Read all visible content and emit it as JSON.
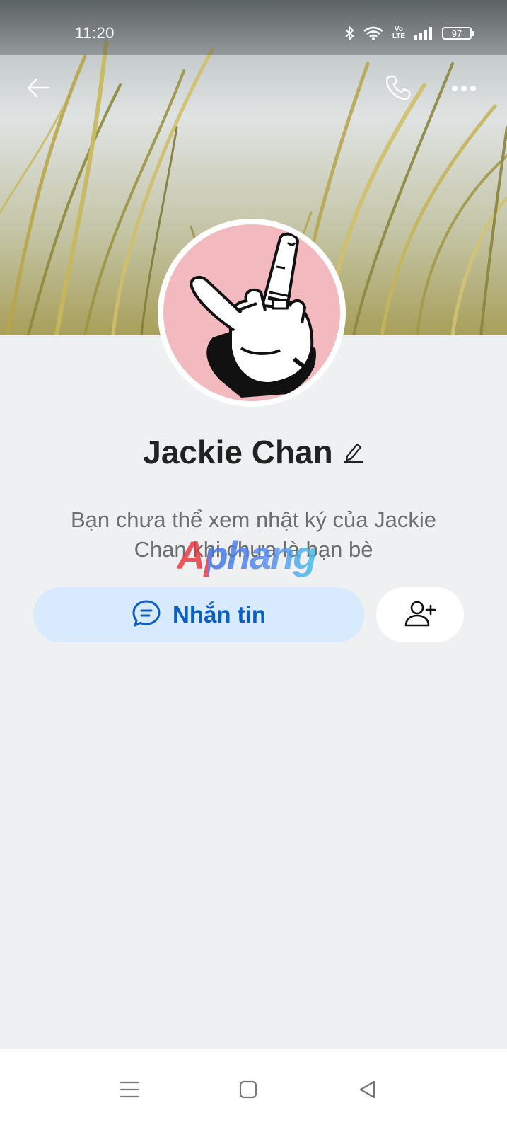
{
  "status_bar": {
    "time": "11:20",
    "network_label_top": "Vo",
    "network_label_bottom": "LTE",
    "battery": "97"
  },
  "header": {
    "icons": [
      "back-arrow-icon",
      "phone-icon",
      "more-options-icon"
    ]
  },
  "profile": {
    "name": "Jackie Chan",
    "notice": "Bạn chưa thể xem nhật ký của Jackie Chan khi chưa là bạn bè"
  },
  "watermark": "Aphang",
  "actions": {
    "message_label": "Nhắn tin",
    "add_friend_icon": "add-friend-icon"
  },
  "system_nav": [
    "menu-icon",
    "home-icon",
    "back-icon"
  ],
  "colors": {
    "accent": "#0b5ec4",
    "message_button_bg": "#d8eafd",
    "page_bg": "#eef0f2",
    "avatar_bg": "#f2b9bf"
  }
}
